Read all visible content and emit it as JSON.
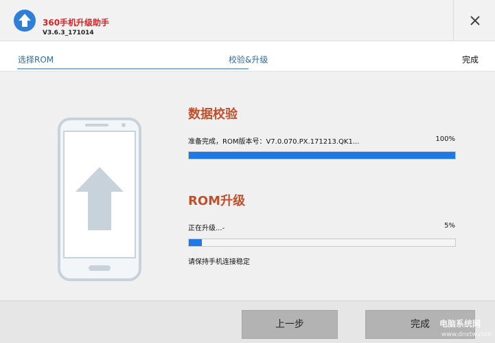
{
  "app": {
    "title": "360手机升级助手",
    "version": "V3.6.3_171014",
    "logo_icon": "arrow-up-circle-icon",
    "close_icon": "close-icon"
  },
  "steps": {
    "items": [
      "选择ROM",
      "校验&升级",
      "完成"
    ],
    "active_index": 1
  },
  "verify": {
    "title": "数据校验",
    "status": "准备完成，ROM版本号：V7.0.070.PX.171213.QK1...",
    "percent_label": "100%",
    "progress": 1.0
  },
  "upgrade": {
    "title": "ROM升级",
    "status": "正在升级...-",
    "percent_label": "5%",
    "progress": 0.05,
    "note": "请保持手机连接稳定"
  },
  "buttons": {
    "prev": "上一步",
    "done": "完成"
  },
  "watermark": {
    "text": "电脑系统网",
    "sub": "www.dnxtw.com"
  },
  "colors": {
    "accent": "#1e78e6",
    "title_red": "#e01f1f",
    "section_orange": "#c0502a",
    "step_blue": "#2e6b9e"
  }
}
